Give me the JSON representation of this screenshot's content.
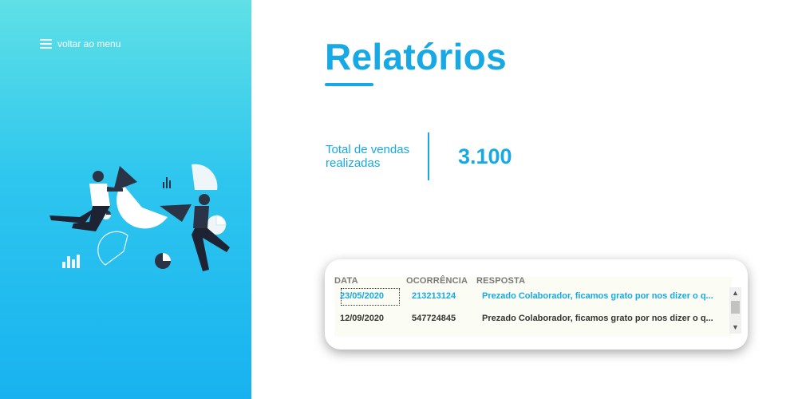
{
  "sidebar": {
    "menu_label": "voltar ao menu"
  },
  "page": {
    "title": "Relatórios"
  },
  "kpi": {
    "label": "Total de vendas realizadas",
    "value": "3.100"
  },
  "table": {
    "headers": [
      "DATA",
      "OCORRÊNCIA",
      "RESPOSTA"
    ],
    "rows": [
      [
        "23/05/2020",
        "213213124",
        "Prezado Colaborador, ficamos grato por nos dizer o q..."
      ],
      [
        "12/09/2020",
        "547724845",
        "Prezado Colaborador, ficamos grato por nos dizer o q..."
      ]
    ],
    "selected_row": 0
  },
  "colors": {
    "accent": "#17a9e6",
    "gradient_top": "#5fe0e6",
    "gradient_bottom": "#18b2f0",
    "text_dark": "#333333",
    "header_gray": "#7a7a7a"
  },
  "icons": [
    "menu-icon",
    "scroll-up-icon",
    "scroll-down-icon"
  ],
  "illustration": "people-assembling-chart-illustration"
}
